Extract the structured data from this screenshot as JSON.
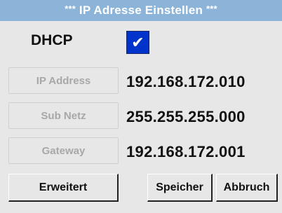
{
  "title": {
    "stars_left": "***",
    "text": "IP Adresse Einstellen",
    "stars_right": "***"
  },
  "dhcp": {
    "label": "DHCP",
    "checked": true,
    "check_glyph": "✔"
  },
  "fields": [
    {
      "label": "IP Address",
      "value": "192.168.172.010"
    },
    {
      "label": "Sub Netz",
      "value": "255.255.255.000"
    },
    {
      "label": "Gateway",
      "value": "192.168.172.001"
    }
  ],
  "buttons": {
    "advanced": "Erweitert",
    "save": "Speicher",
    "cancel": "Abbruch"
  },
  "colors": {
    "title_bar": "#8cb4d9",
    "checkbox": "#0033cc",
    "background": "#e7e7e7"
  }
}
